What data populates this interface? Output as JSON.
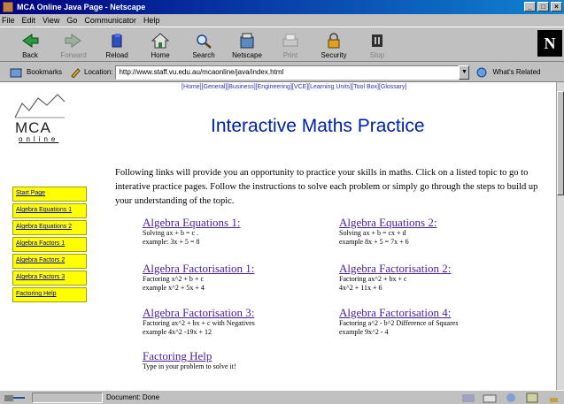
{
  "window": {
    "title": "MCA Online Java Page - Netscape",
    "controls": [
      "_",
      "□",
      "×"
    ]
  },
  "menu": [
    "File",
    "Edit",
    "View",
    "Go",
    "Communicator",
    "Help"
  ],
  "toolbar": [
    {
      "label": "Back",
      "icon": "back-arrow-icon",
      "enabled": true
    },
    {
      "label": "Forward",
      "icon": "forward-arrow-icon",
      "enabled": false
    },
    {
      "label": "Reload",
      "icon": "reload-icon",
      "enabled": true
    },
    {
      "label": "Home",
      "icon": "home-icon",
      "enabled": true
    },
    {
      "label": "Search",
      "icon": "search-icon",
      "enabled": true
    },
    {
      "label": "Netscape",
      "icon": "netscape-icon",
      "enabled": true
    },
    {
      "label": "Print",
      "icon": "print-icon",
      "enabled": false
    },
    {
      "label": "Security",
      "icon": "security-icon",
      "enabled": true
    },
    {
      "label": "Stop",
      "icon": "stop-icon",
      "enabled": false
    }
  ],
  "brand_logo": "N",
  "location": {
    "bookmarks_label": "Bookmarks",
    "label": "Location:",
    "url": "http://www.staff.vu.edu.au/mcaonline/java/index.html",
    "related_label": "What's Related"
  },
  "page": {
    "logo_text": "MCA",
    "logo_sub": "online",
    "topnav": "[Home][General][Business][Engineering][VCE][Learning Units][Tool Box][Glossary]",
    "title": "Interactive Maths Practice",
    "intro": "Following links will provide you an opportunity to practice your skills in maths. Click on a listed topic to go to interative practice pages. Follow the instructions to solve each problem or simply go through the steps to build up your understanding of the topic.",
    "sidebar": [
      "Start Page",
      "Algebra Equations 1",
      "Algebra Equations 2",
      "Algebra Factors 1",
      "Algebra Factors 2",
      "Algebra Factors 3",
      "Factoring Help"
    ],
    "topics": [
      {
        "title": "Algebra Equations 1:",
        "line1": "Solving ax + b = c .",
        "line2": "example: 3x + 5 = 8"
      },
      {
        "title": "Algebra Equations 2: ",
        "line1": "Solving ax + b = cx + d",
        "line2": "example 8x + 5 = 7x + 6"
      },
      {
        "title": "Algebra Factorisation 1:",
        "line1": "Factoring x^2 + b + c",
        "line2": "example x^2 + 5x + 4"
      },
      {
        "title": "Algebra Factorisation 2:",
        "line1": "Factoring ax^2 + bx + c",
        "line2": "4x^2 + 11x + 6"
      },
      {
        "title": "Algebra Factorisation 3:",
        "line1": "Factoring ax^2 + bx + c with Negatives",
        "line2": "example 4x^2 -19x + 12"
      },
      {
        "title": "Algebra Factorisation 4:",
        "line1": "Factoring a^2 - b^2 Difference of Squares",
        "line2": "example 9x^2 - 4"
      },
      {
        "title": "Factoring Help",
        "line1": "Type in your problem to solve it!",
        "line2": ""
      }
    ]
  },
  "status": {
    "text": "Document: Done"
  },
  "colors": {
    "title_blue": "#0020b0",
    "link_purple": "#4a1f9a",
    "sidebar_yellow": "#ffff00",
    "titlebar": "#000080"
  }
}
